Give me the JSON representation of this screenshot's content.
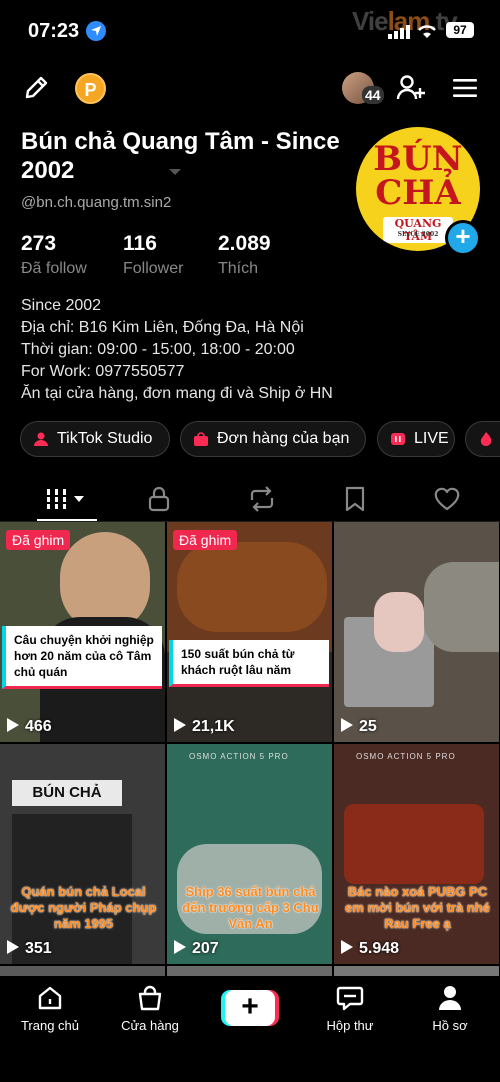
{
  "status_bar": {
    "time": "07:23",
    "battery": "97",
    "watermark_prefix": "Vie",
    "watermark_mid": "lam",
    "watermark_suffix": ".tv"
  },
  "top_bar": {
    "coin_letter": "P",
    "friends_count": "44"
  },
  "profile": {
    "display_name": "Bún chả Quang Tâm - Since 2002",
    "username": "@bn.ch.quang.tm.sin2",
    "avatar_text": [
      "BÚN",
      "CHẢ",
      "QUANG TÂM",
      "SINCE 2002"
    ],
    "add_avatar": "+",
    "stats": [
      {
        "value": "273",
        "label": "Đã follow"
      },
      {
        "value": "116",
        "label": "Follower"
      },
      {
        "value": "2.089",
        "label": "Thích"
      }
    ],
    "bio": [
      "Since 2002",
      "Địa chỉ: B16 Kim Liên, Đống Đa, Hà Nội",
      "Thời gian: 09:00 - 15:00, 18:00 - 20:00",
      "For Work: 0977550577",
      "Ăn tại cửa hàng, đơn mang đi và Ship ở HN"
    ]
  },
  "pills": [
    {
      "label": "TikTok Studio",
      "icon": "studio-icon"
    },
    {
      "label": "Đơn hàng của bạn",
      "icon": "order-bag-icon"
    },
    {
      "label": "LIVE",
      "icon": "live-icon"
    },
    {
      "label": "",
      "icon": "flame-icon"
    }
  ],
  "tabs": [
    "videos-grid-icon",
    "lock-icon",
    "repost-icon",
    "bookmark-icon",
    "heart-icon"
  ],
  "videos": [
    {
      "pinned": "Đã ghim",
      "caption": "Câu chuyện khởi nghiệp hơn 20 năm của cô Tâm chủ quán",
      "views": "466",
      "bg": "#4a4f3a"
    },
    {
      "pinned": "Đã ghim",
      "caption": "150 suất bún chả từ khách ruột lâu năm",
      "views": "21,1K",
      "bg": "#6b3a1f"
    },
    {
      "pinned": "",
      "caption": "",
      "views": "25",
      "bg": "#5a5248"
    },
    {
      "pinned": "",
      "sign": "BÚN CHẢ",
      "caption": "Quán bún chả Local được người Pháp chụp năm 1995",
      "views": "351",
      "bg": "#3a3a3a"
    },
    {
      "pinned": "",
      "osmo": "OSMO ACTION 5 PRO",
      "caption": "Ship 36 suất bún chả đến trường cấp 3 Chu Văn An",
      "views": "207",
      "bg": "#2f6b5a"
    },
    {
      "pinned": "",
      "osmo": "OSMO ACTION 5 PRO",
      "caption": "Bác nào xoá PUBG PC em mời bún với trà nhé Rau Free ạ",
      "views": "5.948",
      "bg": "#4a2a22"
    }
  ],
  "nav": [
    {
      "label": "Trang chủ",
      "icon": "home-icon"
    },
    {
      "label": "Cửa hàng",
      "icon": "shop-bag-icon"
    },
    {
      "label": "",
      "icon": "create-plus-icon"
    },
    {
      "label": "Hộp thư",
      "icon": "inbox-icon"
    },
    {
      "label": "Hồ sơ",
      "icon": "profile-icon"
    }
  ],
  "create_symbol": "+",
  "colors": {
    "accent_pink": "#fe2c55",
    "accent_cyan": "#25f4ee",
    "pin_badge": "#f0274f",
    "avatar_yellow": "#f7d21c",
    "avatar_red": "#c4161c"
  }
}
